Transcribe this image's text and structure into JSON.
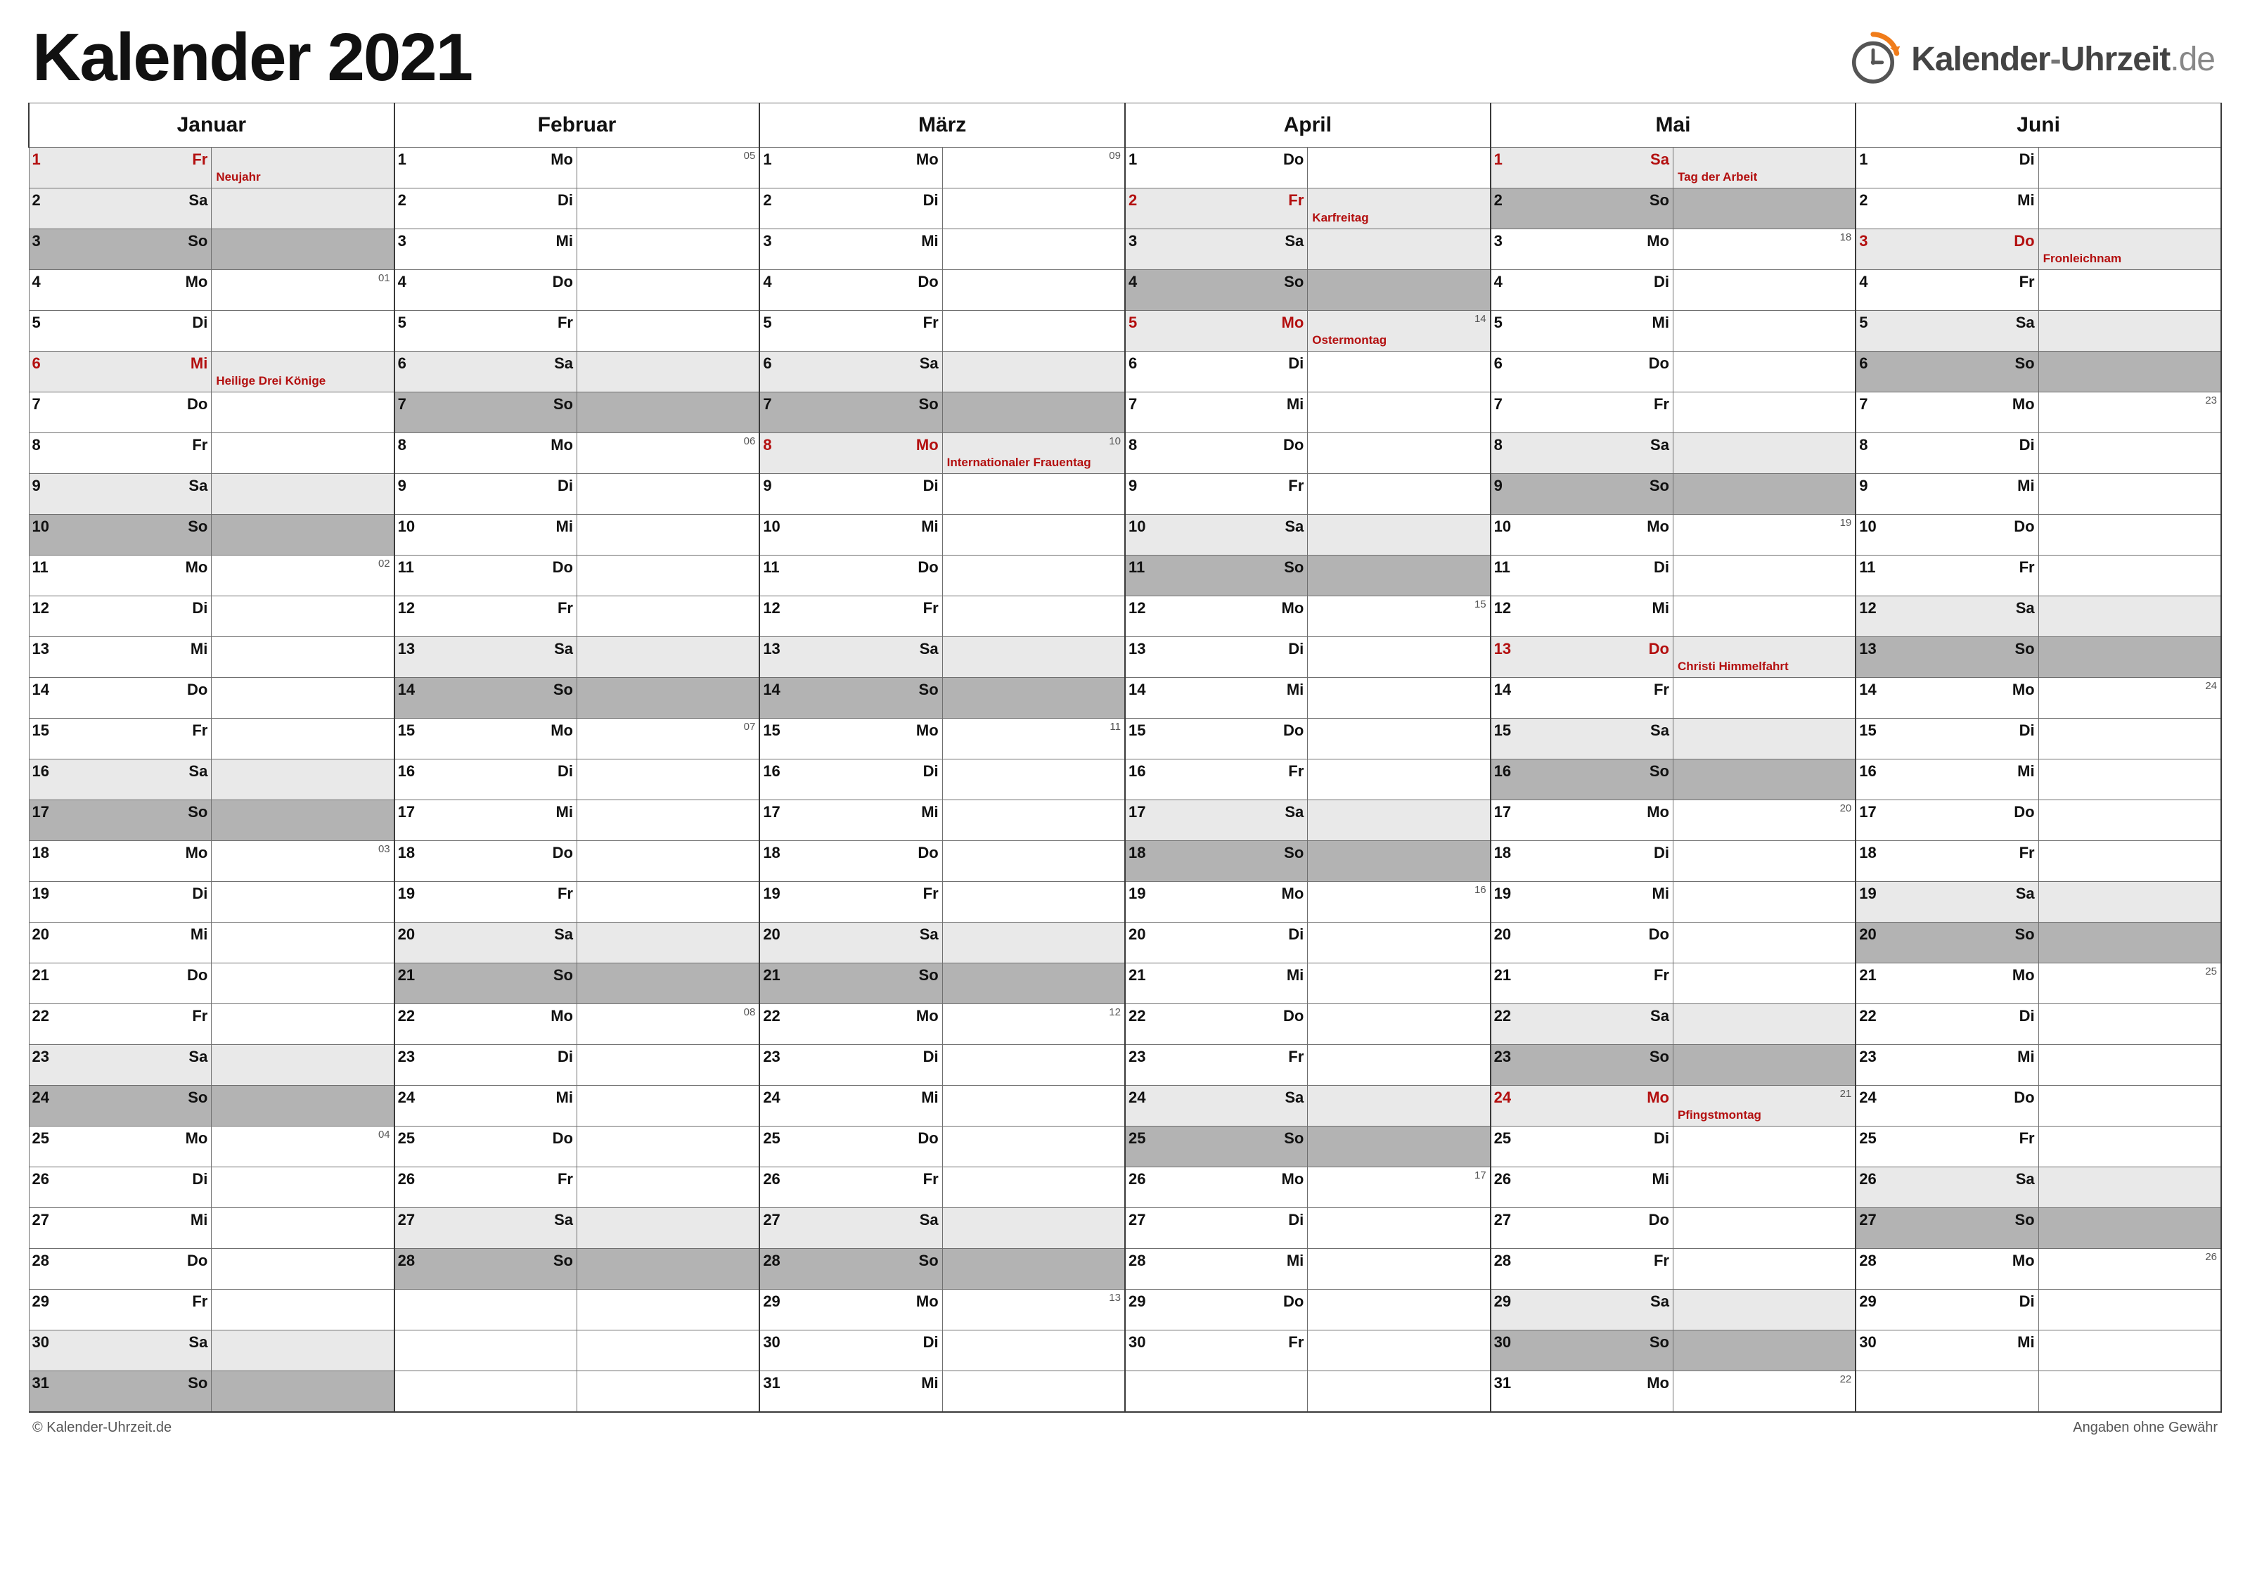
{
  "title": "Kalender 2021",
  "branding": {
    "text_a": "Kalender",
    "dash": "-",
    "text_b": "Uhrzeit",
    "suffix": ".de"
  },
  "footer": {
    "left": "© Kalender-Uhrzeit.de",
    "right": "Angaben ohne Gewähr"
  },
  "months": [
    "Januar",
    "Februar",
    "März",
    "April",
    "Mai",
    "Juni"
  ],
  "weekdays": [
    "Mo",
    "Di",
    "Mi",
    "Do",
    "Fr",
    "Sa",
    "So"
  ],
  "month_first_dow": [
    4,
    0,
    0,
    3,
    5,
    1
  ],
  "month_length": [
    31,
    28,
    31,
    30,
    31,
    30
  ],
  "holidays": {
    "0": {
      "1": "Neujahr",
      "6": "Heilige Drei Könige"
    },
    "2": {
      "8": "Internationaler Frauentag"
    },
    "3": {
      "2": "Karfreitag",
      "5": "Ostermontag"
    },
    "4": {
      "1": "Tag der Arbeit",
      "13": "Christi Himmelfahrt",
      "24": "Pfingstmontag"
    },
    "5": {
      "3": "Fronleichnam"
    }
  },
  "rows": 31,
  "week_one_iso": "Mon_Jan_4"
}
